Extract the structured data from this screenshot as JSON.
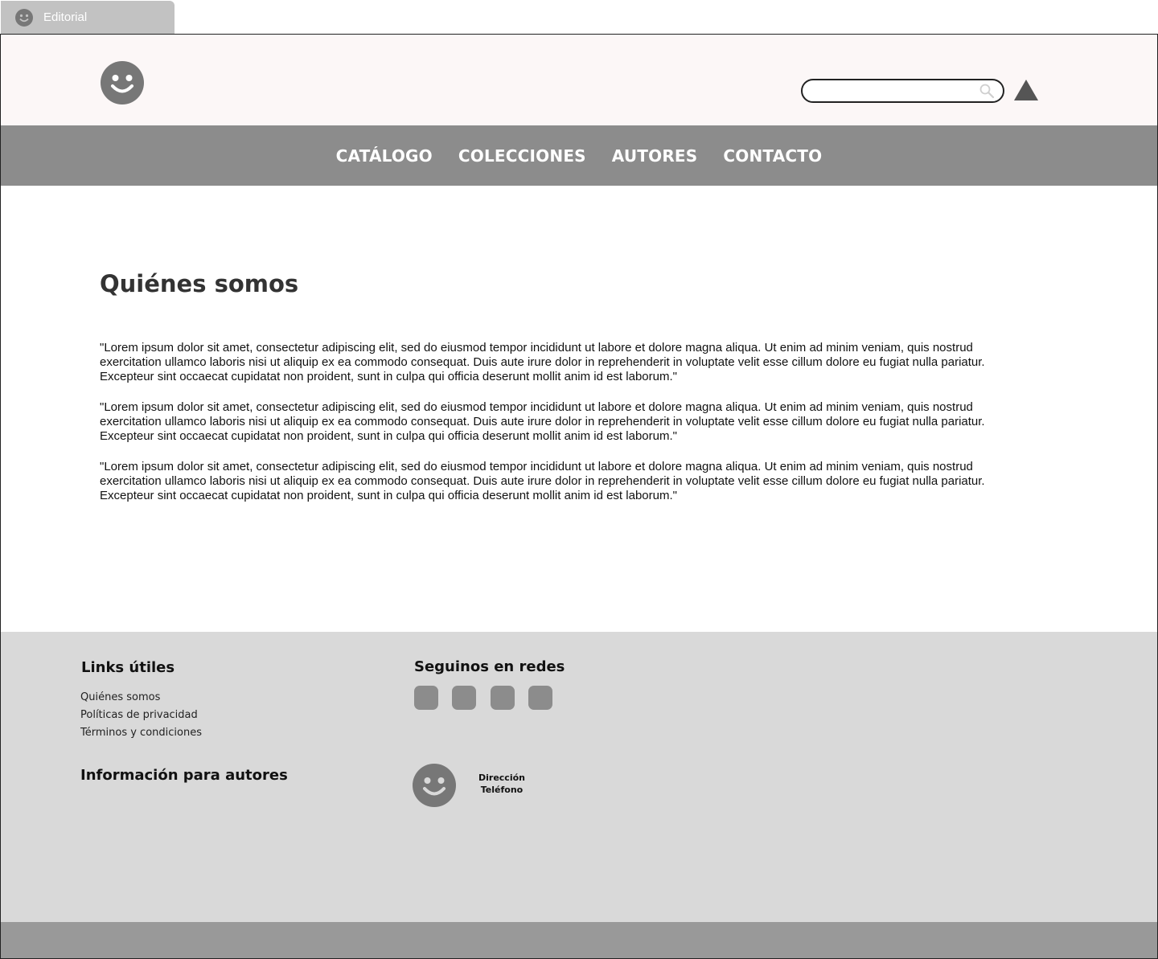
{
  "tab": {
    "label": "Editorial",
    "icon": "smiley-icon"
  },
  "header": {
    "logo_icon": "smiley-icon",
    "search": {
      "placeholder": "",
      "value": "",
      "icon": "search-icon"
    },
    "user_icon": "triangle-icon"
  },
  "nav": {
    "items": [
      {
        "label": "CATÁLOGO"
      },
      {
        "label": "COLECCIONES"
      },
      {
        "label": "AUTORES"
      },
      {
        "label": "CONTACTO"
      }
    ]
  },
  "main": {
    "title": "Quiénes somos",
    "paragraphs": [
      "\"Lorem ipsum dolor sit amet, consectetur adipiscing elit, sed do eiusmod tempor incididunt ut labore et dolore magna aliqua. Ut enim ad minim veniam, quis nostrud exercitation ullamco laboris nisi ut aliquip ex ea commodo consequat. Duis aute irure dolor in reprehenderit in voluptate velit esse cillum dolore eu fugiat nulla pariatur. Excepteur sint occaecat cupidatat non proident, sunt in culpa qui officia deserunt mollit anim id est laborum.\"",
      "\"Lorem ipsum dolor sit amet, consectetur adipiscing elit, sed do eiusmod tempor incididunt ut labore et dolore magna aliqua. Ut enim ad minim veniam, quis nostrud exercitation ullamco laboris nisi ut aliquip ex ea commodo consequat. Duis aute irure dolor in reprehenderit in voluptate velit esse cillum dolore eu fugiat nulla pariatur. Excepteur sint occaecat cupidatat non proident, sunt in culpa qui officia deserunt mollit anim id est laborum.\"",
      "\"Lorem ipsum dolor sit amet, consectetur adipiscing elit, sed do eiusmod tempor incididunt ut labore et dolore magna aliqua. Ut enim ad minim veniam, quis nostrud exercitation ullamco laboris nisi ut aliquip ex ea commodo consequat. Duis aute irure dolor in reprehenderit in voluptate velit esse cillum dolore eu fugiat nulla pariatur. Excepteur sint occaecat cupidatat non proident, sunt in culpa qui officia deserunt mollit anim id est laborum.\""
    ]
  },
  "footer": {
    "links_title": "Links útiles",
    "links": [
      "Quiénes somos",
      "Políticas de privacidad",
      "Términos y condiciones"
    ],
    "authors_title": "Información para autores",
    "social_title": "Seguinos en redes",
    "social_icons": [
      "social-icon-1",
      "social-icon-2",
      "social-icon-3",
      "social-icon-4"
    ],
    "logo_icon": "smiley-icon",
    "contact": {
      "address": "Dirección",
      "phone": "Teléfono"
    }
  },
  "colors": {
    "nav_bg": "#8c8c8c",
    "header_bg": "#fcf7f7",
    "footer_bg": "#d9d9d9",
    "bottom_bar_bg": "#999999",
    "icon_gray": "#777777"
  }
}
